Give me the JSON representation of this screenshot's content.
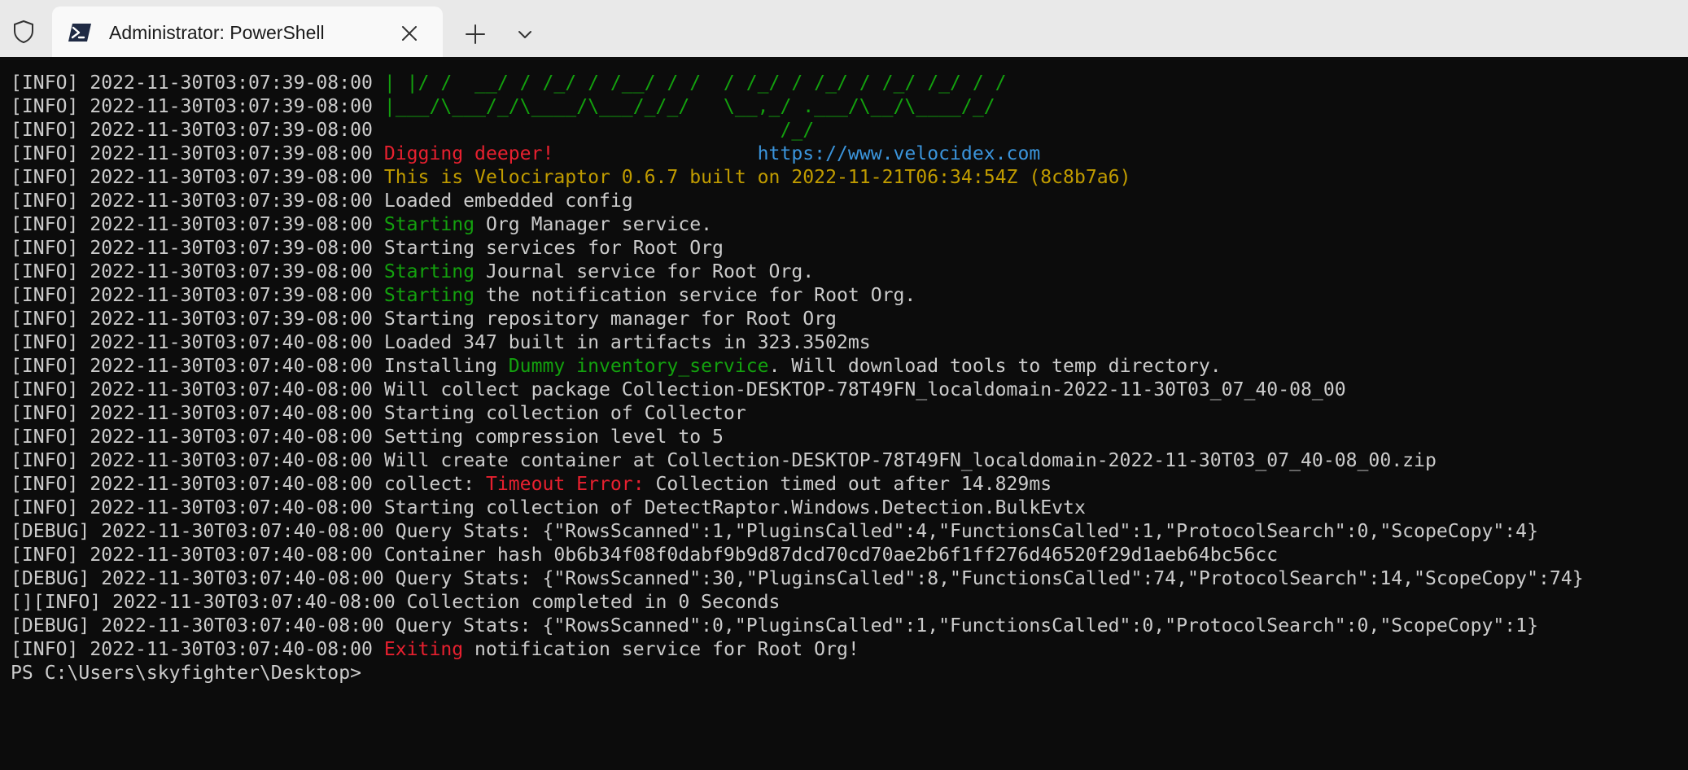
{
  "window": {
    "tab_title": "Administrator: PowerShell"
  },
  "icons": {
    "shield": "shield-icon",
    "powershell": "powershell-icon",
    "close": "close-icon",
    "new_tab": "plus-icon",
    "dropdown": "chevron-down-icon"
  },
  "colors": {
    "background": "#0c0c0c",
    "text": "#cccccc",
    "green": "#13a10e",
    "red": "#e7202f",
    "yellow": "#c19c00",
    "blue": "#3b95dc"
  },
  "terminal": {
    "lines": [
      [
        {
          "t": "[INFO] 2022-11-30T03:07:39-08:00 "
        },
        {
          "t": "| |/ /  __/ / /_/ / /__/ / /  / /_/ / /_/ / /_/ /_/ / /",
          "c": "g"
        }
      ],
      [
        {
          "t": "[INFO] 2022-11-30T03:07:39-08:00 "
        },
        {
          "t": "|___/\\___/_/\\____/\\___/_/_/   \\__,_/ .___/\\__/\\____/_/",
          "c": "g"
        }
      ],
      [
        {
          "t": "[INFO] 2022-11-30T03:07:39-08:00 "
        },
        {
          "t": "                                   /_/",
          "c": "g"
        }
      ],
      [
        {
          "t": "[INFO] 2022-11-30T03:07:39-08:00 "
        },
        {
          "t": "Digging deeper!",
          "c": "r"
        },
        {
          "t": "                  "
        },
        {
          "t": "https://www.velocidex.com",
          "c": "b"
        }
      ],
      [
        {
          "t": "[INFO] 2022-11-30T03:07:39-08:00 "
        },
        {
          "t": "This is Velociraptor 0.6.7 built on 2022-11-21T06:34:54Z (8c8b7a6)",
          "c": "y"
        }
      ],
      [
        {
          "t": "[INFO] 2022-11-30T03:07:39-08:00 Loaded embedded config"
        }
      ],
      [
        {
          "t": "[INFO] 2022-11-30T03:07:39-08:00 "
        },
        {
          "t": "Starting",
          "c": "g"
        },
        {
          "t": " Org Manager service."
        }
      ],
      [
        {
          "t": "[INFO] 2022-11-30T03:07:39-08:00 Starting services for Root Org"
        }
      ],
      [
        {
          "t": "[INFO] 2022-11-30T03:07:39-08:00 "
        },
        {
          "t": "Starting",
          "c": "g"
        },
        {
          "t": " Journal service for Root Org."
        }
      ],
      [
        {
          "t": "[INFO] 2022-11-30T03:07:39-08:00 "
        },
        {
          "t": "Starting",
          "c": "g"
        },
        {
          "t": " the notification service for Root Org."
        }
      ],
      [
        {
          "t": "[INFO] 2022-11-30T03:07:39-08:00 Starting repository manager for Root Org"
        }
      ],
      [
        {
          "t": "[INFO] 2022-11-30T03:07:40-08:00 Loaded 347 built in artifacts in 323.3502ms"
        }
      ],
      [
        {
          "t": "[INFO] 2022-11-30T03:07:40-08:00 Installing "
        },
        {
          "t": "Dummy inventory_service",
          "c": "g"
        },
        {
          "t": ". Will download tools to temp directory."
        }
      ],
      [
        {
          "t": "[INFO] 2022-11-30T03:07:40-08:00 Will collect package Collection-DESKTOP-78T49FN_localdomain-2022-11-30T03_07_40-08_00"
        }
      ],
      [
        {
          "t": "[INFO] 2022-11-30T03:07:40-08:00 Starting collection of Collector"
        }
      ],
      [
        {
          "t": "[INFO] 2022-11-30T03:07:40-08:00 Setting compression level to 5"
        }
      ],
      [
        {
          "t": "[INFO] 2022-11-30T03:07:40-08:00 Will create container at Collection-DESKTOP-78T49FN_localdomain-2022-11-30T03_07_40-08_00.zip"
        }
      ],
      [
        {
          "t": "[INFO] 2022-11-30T03:07:40-08:00 collect: "
        },
        {
          "t": "Timeout Error:",
          "c": "r"
        },
        {
          "t": " Collection timed out after 14.829ms"
        }
      ],
      [
        {
          "t": "[INFO] 2022-11-30T03:07:40-08:00 Starting collection of DetectRaptor.Windows.Detection.BulkEvtx"
        }
      ],
      [
        {
          "t": "[DEBUG] 2022-11-30T03:07:40-08:00 Query Stats: {\"RowsScanned\":1,\"PluginsCalled\":4,\"FunctionsCalled\":1,\"ProtocolSearch\":0,\"ScopeCopy\":4}"
        }
      ],
      [
        {
          "t": "[INFO] 2022-11-30T03:07:40-08:00 Container hash 0b6b34f08f0dabf9b9d87dcd70cd70ae2b6f1ff276d46520f29d1aeb64bc56cc"
        }
      ],
      [
        {
          "t": "[DEBUG] 2022-11-30T03:07:40-08:00 Query Stats: {\"RowsScanned\":30,\"PluginsCalled\":8,\"FunctionsCalled\":74,\"ProtocolSearch\":14,\"ScopeCopy\":74}"
        }
      ],
      [
        {
          "t": "[][INFO] 2022-11-30T03:07:40-08:00 Collection completed in 0 Seconds"
        }
      ],
      [
        {
          "t": "[DEBUG] 2022-11-30T03:07:40-08:00 Query Stats: {\"RowsScanned\":0,\"PluginsCalled\":1,\"FunctionsCalled\":0,\"ProtocolSearch\":0,\"ScopeCopy\":1}"
        }
      ],
      [
        {
          "t": "[INFO] 2022-11-30T03:07:40-08:00 "
        },
        {
          "t": "Exiting",
          "c": "r"
        },
        {
          "t": " notification service for Root Org!"
        }
      ],
      [
        {
          "t": "PS C:\\Users\\skyfighter\\Desktop>"
        }
      ]
    ]
  }
}
